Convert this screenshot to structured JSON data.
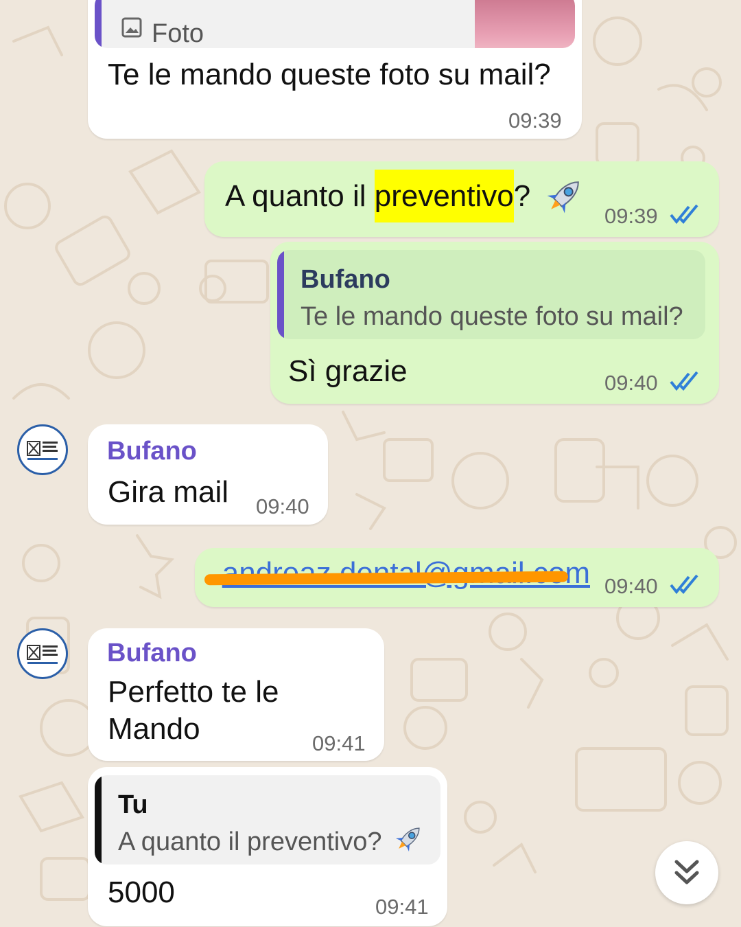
{
  "colors": {
    "background": "#efe7dc",
    "incoming_bubble": "#ffffff",
    "outgoing_bubble": "#dcf8c6",
    "sender_name": "#6a52c8",
    "read_ticks": "#2f7fd8",
    "highlight": "#ffff00"
  },
  "messages": [
    {
      "quote_label": "Foto",
      "quote_icon": "image-icon",
      "text": "Te le mando queste foto su mail?",
      "time": "09:39"
    },
    {
      "text_before": "A quanto il ",
      "text_highlight": "preventivo",
      "text_after": "?",
      "emoji": "rocket",
      "time": "09:39",
      "status": "read"
    },
    {
      "quote_sender": "Bufano",
      "quote_text": "Te le mando queste foto su mail?",
      "text": "Sì grazie",
      "time": "09:40",
      "status": "read"
    },
    {
      "sender": "Bufano",
      "text": "Gira mail",
      "time": "09:40"
    },
    {
      "link_text": "andreaz.dental@gmail.com",
      "time": "09:40",
      "status": "read"
    },
    {
      "sender": "Bufano",
      "text_line1": "Perfetto te le",
      "text_line2": "Mando",
      "time": "09:41"
    },
    {
      "quote_sender": "Tu",
      "quote_text": "A quanto il preventivo?",
      "quote_emoji": "rocket",
      "text": "5000",
      "time": "09:41"
    }
  ],
  "scroll_button": {
    "icon": "double-chevron-down-icon"
  }
}
